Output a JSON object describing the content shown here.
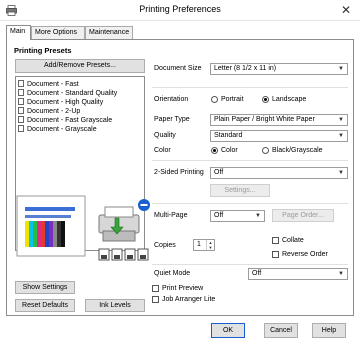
{
  "window": {
    "title": "Printing Preferences",
    "close_glyph": "✕"
  },
  "tabs": [
    {
      "label": "Main"
    },
    {
      "label": "More Options"
    },
    {
      "label": "Maintenance"
    }
  ],
  "presets": {
    "header": "Printing Presets",
    "add_remove_label": "Add/Remove Presets...",
    "items": [
      "Document - Fast",
      "Document - Standard Quality",
      "Document - High Quality",
      "Document - 2-Up",
      "Document - Fast Grayscale",
      "Document - Grayscale"
    ]
  },
  "settings": {
    "document_size": {
      "label": "Document Size",
      "value": "Letter (8 1/2 x 11 in)"
    },
    "orientation": {
      "label": "Orientation",
      "portrait": "Portrait",
      "landscape": "Landscape",
      "selected": "Landscape"
    },
    "paper_type": {
      "label": "Paper Type",
      "value": "Plain Paper / Bright White Paper"
    },
    "quality": {
      "label": "Quality",
      "value": "Standard"
    },
    "color": {
      "label": "Color",
      "color": "Color",
      "bw": "Black/Grayscale",
      "selected": "Color"
    },
    "two_sided": {
      "label": "2-Sided Printing",
      "value": "Off",
      "settings_label": "Settings..."
    },
    "multipage": {
      "label": "Multi-Page",
      "value": "Off",
      "page_order_label": "Page Order..."
    },
    "copies": {
      "label": "Copies",
      "value": "1"
    },
    "collate": {
      "label": "Collate",
      "checked": false
    },
    "reverse_order": {
      "label": "Reverse Order",
      "checked": false
    },
    "quiet_mode": {
      "label": "Quiet Mode",
      "value": "Off"
    },
    "print_preview": {
      "label": "Print Preview",
      "checked": false
    },
    "job_arranger": {
      "label": "Job Arranger Lite",
      "checked": false
    }
  },
  "left_buttons": {
    "show_settings": "Show Settings",
    "reset_defaults": "Reset Defaults",
    "ink_levels": "Ink Levels"
  },
  "footer": {
    "ok": "OK",
    "cancel": "Cancel",
    "help": "Help"
  },
  "colors": {
    "accent_blue": "#1a5fd0",
    "printer_green": "#3aa23a"
  }
}
